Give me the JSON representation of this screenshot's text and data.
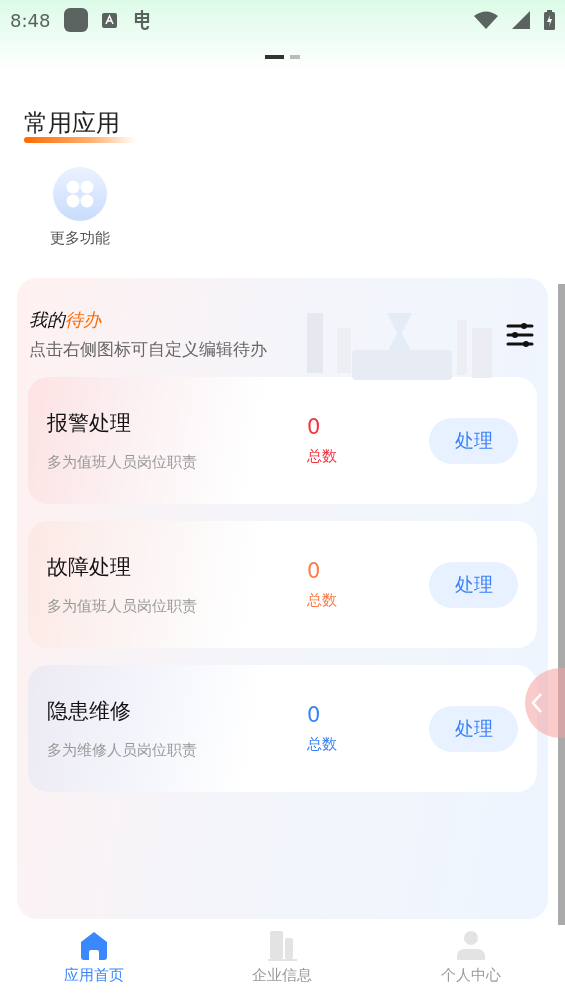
{
  "status_bar": {
    "time": "8:48"
  },
  "pager": [
    {
      "selected": true
    },
    {
      "selected": false
    }
  ],
  "common_apps": {
    "title": "常用应用",
    "items": [
      {
        "label": "更多功能"
      }
    ]
  },
  "todo": {
    "title_prefix": "我的",
    "title_highlight": "待办",
    "subtitle": "点击右侧图标可自定义编辑待办",
    "tasks": [
      {
        "name": "报警处理",
        "description": "多为值班人员岗位职责",
        "count": "0",
        "count_label": "总数",
        "button": "处理",
        "color": "#f5333f"
      },
      {
        "name": "故障处理",
        "description": "多为值班人员岗位职责",
        "count": "0",
        "count_label": "总数",
        "button": "处理",
        "color": "#ff7a45"
      },
      {
        "name": "隐患维修",
        "description": "多为维修人员岗位职责",
        "count": "0",
        "count_label": "总数",
        "button": "处理",
        "color": "#3a82f7"
      }
    ]
  },
  "bottom_nav": [
    {
      "label": "应用首页",
      "kind": "home",
      "selected": true
    },
    {
      "label": "企业信息",
      "kind": "building",
      "selected": false
    },
    {
      "label": "个人中心",
      "kind": "person",
      "selected": false
    }
  ]
}
